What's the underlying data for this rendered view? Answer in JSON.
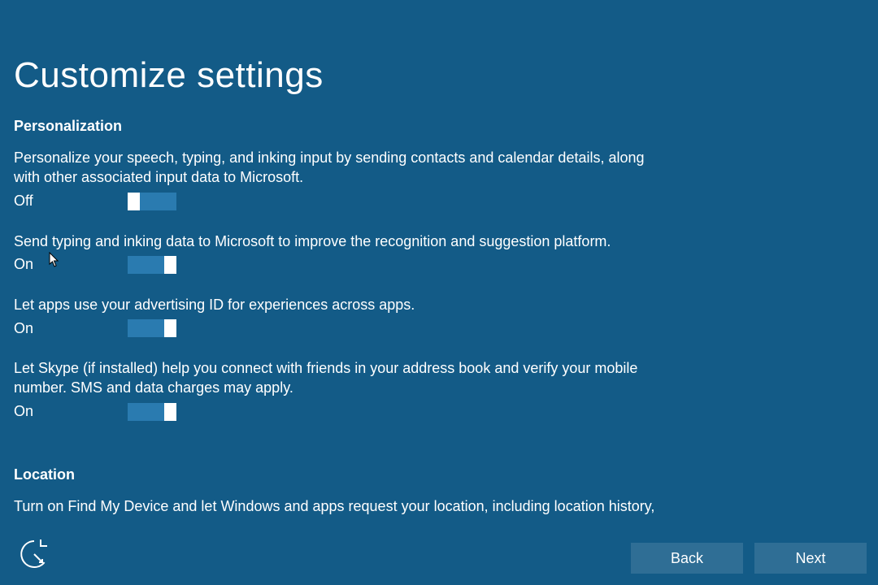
{
  "title": "Customize settings",
  "sections": {
    "personalization": {
      "header": "Personalization",
      "items": [
        {
          "desc": "Personalize your speech, typing, and inking input by sending contacts and calendar details, along with other associated input data to Microsoft.",
          "state": "Off"
        },
        {
          "desc": "Send typing and inking data to Microsoft to improve the recognition and suggestion platform.",
          "state": "On"
        },
        {
          "desc": "Let apps use your advertising ID for experiences across apps.",
          "state": "On"
        },
        {
          "desc": "Let Skype (if installed) help you connect with friends in your address book and verify your mobile number. SMS and data charges may apply.",
          "state": "On"
        }
      ]
    },
    "location": {
      "header": "Location",
      "desc": "Turn on Find My Device and let Windows and apps request your location, including location history,"
    }
  },
  "buttons": {
    "back": "Back",
    "next": "Next"
  }
}
